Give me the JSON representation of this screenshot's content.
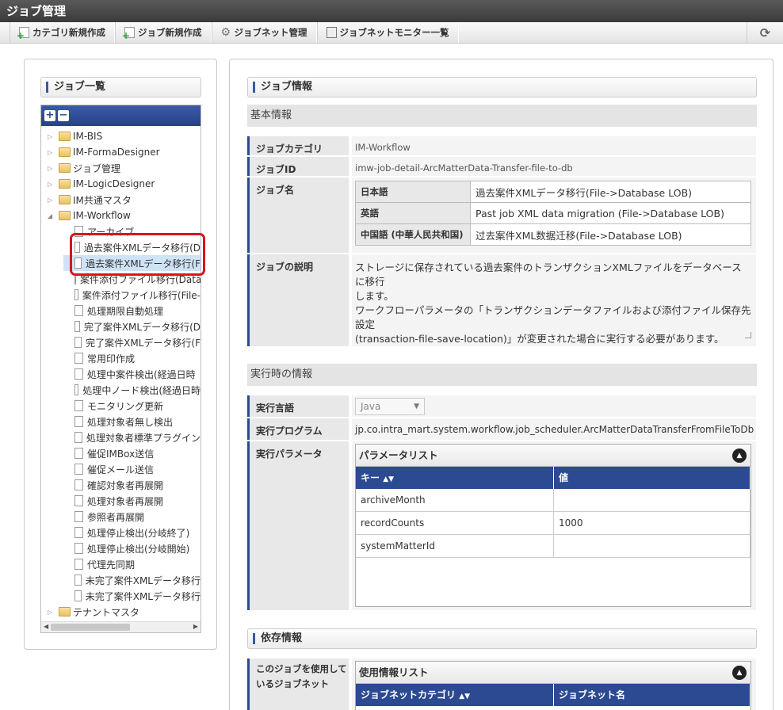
{
  "app": {
    "title": "ジョブ管理"
  },
  "toolbar": {
    "buttons": [
      {
        "label": "カテゴリ新規作成",
        "icon": "new-document-icon"
      },
      {
        "label": "ジョブ新規作成",
        "icon": "new-document-icon"
      },
      {
        "label": "ジョブネット管理",
        "icon": "gear-icon"
      },
      {
        "label": "ジョブネットモニター一覧",
        "icon": "monitor-icon"
      }
    ],
    "refresh_icon": "refresh-icon"
  },
  "left": {
    "title": "ジョブ一覧",
    "tree": [
      {
        "label": "IM-BIS",
        "type": "folder",
        "level": 0
      },
      {
        "label": "IM-FormaDesigner",
        "type": "folder",
        "level": 0
      },
      {
        "label": "ジョブ管理",
        "type": "folder",
        "level": 0
      },
      {
        "label": "IM-LogicDesigner",
        "type": "folder",
        "level": 0
      },
      {
        "label": "IM共通マスタ",
        "type": "folder",
        "level": 0
      },
      {
        "label": "IM-Workflow",
        "type": "folder",
        "level": 0,
        "expanded": true
      },
      {
        "label": "アーカイブ",
        "type": "doc",
        "level": 1
      },
      {
        "label": "過去案件XMLデータ移行(D",
        "type": "doc",
        "level": 1
      },
      {
        "label": "過去案件XMLデータ移行(F",
        "type": "doc",
        "level": 1,
        "selected": true
      },
      {
        "label": "案件添付ファイル移行(Data",
        "type": "doc",
        "level": 1
      },
      {
        "label": "案件添付ファイル移行(File-",
        "type": "doc",
        "level": 1
      },
      {
        "label": "処理期限自動処理",
        "type": "doc",
        "level": 1
      },
      {
        "label": "完了案件XMLデータ移行(D",
        "type": "doc",
        "level": 1
      },
      {
        "label": "完了案件XMLデータ移行(F",
        "type": "doc",
        "level": 1
      },
      {
        "label": "常用印作成",
        "type": "doc",
        "level": 1
      },
      {
        "label": "処理中案件検出(経過日時",
        "type": "doc",
        "level": 1
      },
      {
        "label": "処理中ノード検出(経過日時",
        "type": "doc",
        "level": 1
      },
      {
        "label": "モニタリング更新",
        "type": "doc",
        "level": 1
      },
      {
        "label": "処理対象者無し検出",
        "type": "doc",
        "level": 1
      },
      {
        "label": "処理対象者標準プラグイン",
        "type": "doc",
        "level": 1
      },
      {
        "label": "催促IMBox送信",
        "type": "doc",
        "level": 1
      },
      {
        "label": "催促メール送信",
        "type": "doc",
        "level": 1
      },
      {
        "label": "確認対象者再展開",
        "type": "doc",
        "level": 1
      },
      {
        "label": "処理対象者再展開",
        "type": "doc",
        "level": 1
      },
      {
        "label": "参照者再展開",
        "type": "doc",
        "level": 1
      },
      {
        "label": "処理停止検出(分岐終了)",
        "type": "doc",
        "level": 1
      },
      {
        "label": "処理停止検出(分岐開始)",
        "type": "doc",
        "level": 1
      },
      {
        "label": "代理先同期",
        "type": "doc",
        "level": 1
      },
      {
        "label": "未完了案件XMLデータ移行",
        "type": "doc",
        "level": 1
      },
      {
        "label": "未完了案件XMLデータ移行",
        "type": "doc",
        "level": 1
      },
      {
        "label": "テナントマスタ",
        "type": "folder",
        "level": 0
      }
    ]
  },
  "right": {
    "title": "ジョブ情報",
    "basic": {
      "heading": "基本情報",
      "category_label": "ジョブカテゴリ",
      "category_value": "IM-Workflow",
      "id_label": "ジョブID",
      "id_value": "imw-job-detail-ArcMatterData-Transfer-file-to-db",
      "name_label": "ジョブ名",
      "names": [
        {
          "lang": "日本語",
          "value": "過去案件XMLデータ移行(File->Database LOB)"
        },
        {
          "lang": "英語",
          "value": "Past job XML data migration (File->Database LOB)"
        },
        {
          "lang": "中国語 (中華人民共和国)",
          "value": "过去案件XML数据迁移(File->Database LOB)"
        }
      ],
      "desc_label": "ジョブの説明",
      "desc_lines": [
        "ストレージに保存されている過去案件のトランザクションXMLファイルをデータベースに移行",
        "します。",
        "ワークフローパラメータの「トランザクションデータファイルおよび添付ファイル保存先設定",
        "(transaction-file-save-location)」が変更された場合に実行する必要があります。"
      ]
    },
    "runtime": {
      "heading": "実行時の情報",
      "lang_label": "実行言語",
      "lang_value": "Java",
      "program_label": "実行プログラム",
      "program_value": "jp.co.intra_mart.system.workflow.job_scheduler.ArcMatterDataTransferFromFileToDb",
      "param_label": "実行パラメータ",
      "param_list_title": "パラメータリスト",
      "param_columns": [
        "キー",
        "値"
      ],
      "params": [
        {
          "key": "archiveMonth",
          "value": ""
        },
        {
          "key": "recordCounts",
          "value": "1000"
        },
        {
          "key": "systemMatterId",
          "value": ""
        }
      ]
    },
    "depend": {
      "title": "依存情報",
      "usage_label": "このジョブを使用しているジョブネット",
      "usage_list_title": "使用情報リスト",
      "usage_columns": [
        "ジョブネットカテゴリ",
        "ジョブネット名"
      ]
    }
  }
}
